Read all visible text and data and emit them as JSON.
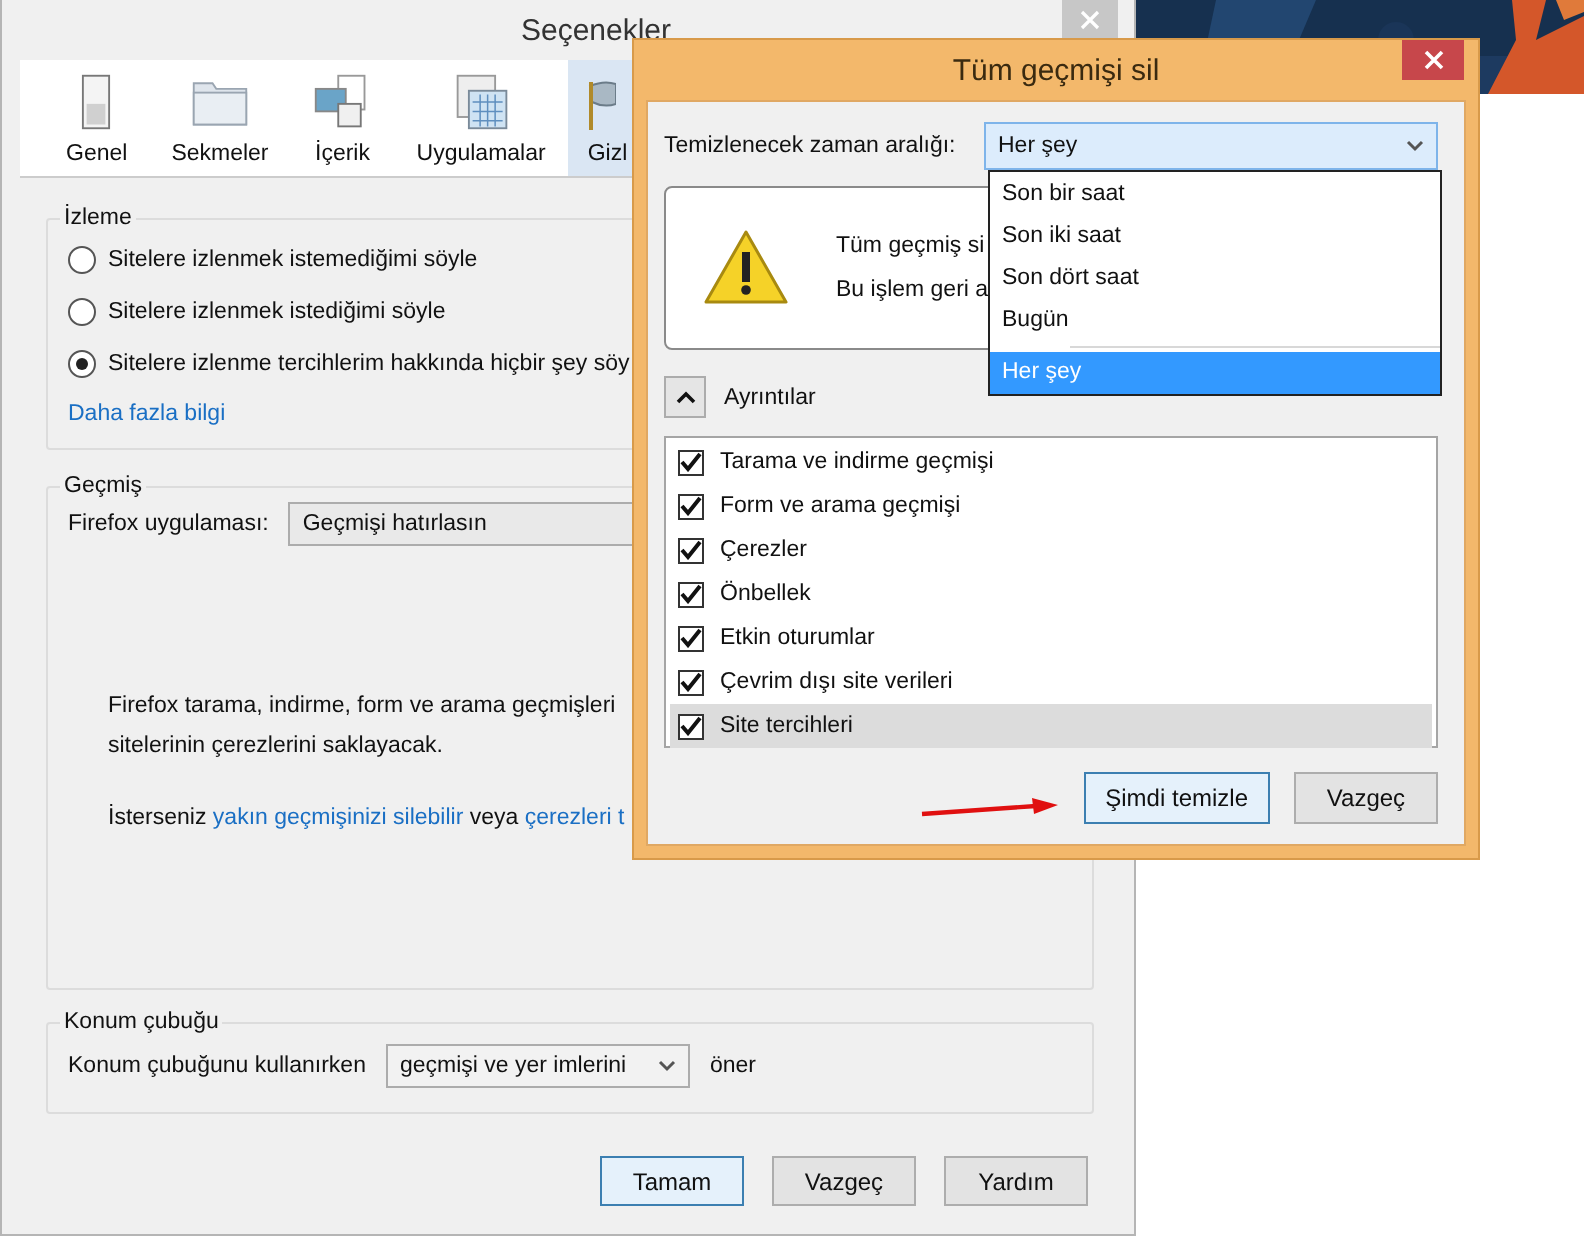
{
  "options_window": {
    "title": "Seçenekler",
    "tabs": [
      {
        "label": "Genel",
        "selected": false
      },
      {
        "label": "Sekmeler",
        "selected": false
      },
      {
        "label": "İçerik",
        "selected": false
      },
      {
        "label": "Uygulamalar",
        "selected": false
      },
      {
        "label": "Gizl",
        "selected": true
      }
    ],
    "tracking": {
      "title": "İzleme",
      "options": [
        {
          "label": "Sitelere izlenmek istemediğimi söyle",
          "selected": false
        },
        {
          "label": "Sitelere izlenmek istediğimi söyle",
          "selected": false
        },
        {
          "label": "Sitelere izlenme tercihlerim hakkında hiçbir şey söy",
          "selected": true
        }
      ],
      "link": "Daha fazla bilgi"
    },
    "history": {
      "title": "Geçmiş",
      "label": "Firefox uygulaması:",
      "value": "Geçmişi hatırlasın",
      "description": [
        "Firefox tarama, indirme, form ve arama geçmişleri",
        "sitelerinin çerezlerini saklayacak."
      ],
      "hint": {
        "prefix": "İsterseniz",
        "link": "yakın geçmişinizi silebilir",
        "middle": "veya",
        "link_2": "çerezleri t"
      }
    },
    "location_bar": {
      "title": "Konum çubuğu",
      "label": "Konum çubuğunu kullanırken",
      "value": "geçmişi ve yer imlerini",
      "suffix": "öner"
    },
    "buttons": [
      {
        "label": "Tamam",
        "focused": true
      },
      {
        "label": "Vazgeç",
        "focused": false
      },
      {
        "label": "Yardım",
        "focused": false
      }
    ]
  },
  "clear_dialog": {
    "title": "Tüm geçmişi sil",
    "range_label": "Temizlenecek zaman aralığı:",
    "range_value": "Her şey",
    "warning": [
      "Tüm geçmiş si",
      "Bu işlem geri a"
    ],
    "range_options": [
      {
        "label": "Son bir saat",
        "selected": false
      },
      {
        "label": "Son iki saat",
        "selected": false
      },
      {
        "label": "Son dört saat",
        "selected": false
      },
      {
        "label": "Bugün",
        "selected": false
      },
      {
        "label": "Her şey",
        "selected": true
      }
    ],
    "details": {
      "label": "Ayrıntılar",
      "expanded": true
    },
    "items": [
      {
        "label": "Tarama ve indirme geçmişi",
        "checked": true,
        "hovered": false
      },
      {
        "label": "Form ve arama geçmişi",
        "checked": true,
        "hovered": false
      },
      {
        "label": "Çerezler",
        "checked": true,
        "hovered": false
      },
      {
        "label": "Önbellek",
        "checked": true,
        "hovered": false
      },
      {
        "label": "Etkin oturumlar",
        "checked": true,
        "hovered": false
      },
      {
        "label": "Çevrim dışı site verileri",
        "checked": true,
        "hovered": false
      },
      {
        "label": "Site tercihleri",
        "checked": true,
        "hovered": true
      }
    ],
    "buttons": [
      {
        "label": "Şimdi temizle",
        "focused": true
      },
      {
        "label": "Vazgeç",
        "focused": false
      }
    ]
  }
}
